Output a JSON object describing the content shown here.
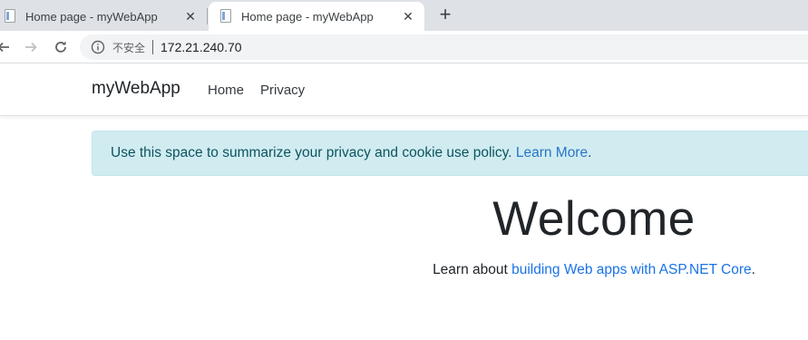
{
  "browser": {
    "tabs": [
      {
        "title": "Home page - myWebApp",
        "active": false
      },
      {
        "title": "Home page - myWebApp",
        "active": true
      }
    ],
    "close_glyph": "✕",
    "new_tab_glyph": "+",
    "address": {
      "security_label": "不安全",
      "url": "172.21.240.70"
    },
    "icons": [
      "page-favicon-icon",
      "close-icon",
      "plus-icon",
      "back-arrow-icon",
      "forward-arrow-icon",
      "reload-icon",
      "info-icon"
    ]
  },
  "site": {
    "brand": "myWebApp",
    "nav": [
      {
        "label": "Home"
      },
      {
        "label": "Privacy"
      }
    ],
    "cookie_alert": {
      "text": "Use this space to summarize your privacy and cookie use policy. ",
      "link": "Learn More",
      "suffix": "."
    },
    "heading": "Welcome",
    "learn": {
      "prefix": "Learn about ",
      "link": "building Web apps with ASP.NET Core",
      "suffix": "."
    }
  },
  "colors": {
    "tabstrip": "#dee1e6",
    "alert_bg": "#d1ecf1",
    "alert_text": "#0c5460",
    "link": "#1a73e8"
  }
}
